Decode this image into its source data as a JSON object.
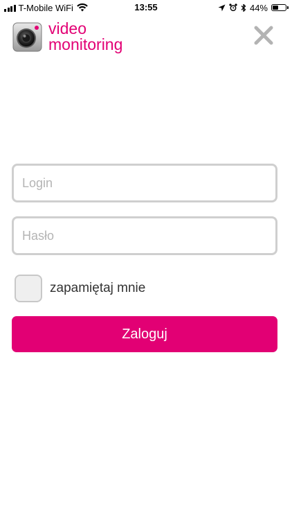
{
  "status_bar": {
    "carrier": "T-Mobile WiFi",
    "time": "13:55",
    "battery_percent": "44%",
    "battery_level": 0.44,
    "icons": [
      "signal-icon",
      "wifi-icon",
      "location-icon",
      "alarm-icon",
      "bluetooth-icon",
      "battery-icon"
    ]
  },
  "header": {
    "title_line1": "video",
    "title_line2": "monitoring",
    "logo_icon": "camera-icon",
    "close_icon": "close-icon"
  },
  "form": {
    "login": {
      "value": "",
      "placeholder": "Login"
    },
    "password": {
      "value": "",
      "placeholder": "Hasło"
    },
    "remember": {
      "label": "zapamiętaj mnie",
      "checked": false
    },
    "submit_label": "Zaloguj"
  },
  "colors": {
    "brand": "#e20074",
    "field_border": "#cfcfcf",
    "placeholder": "#b4b4b4"
  }
}
